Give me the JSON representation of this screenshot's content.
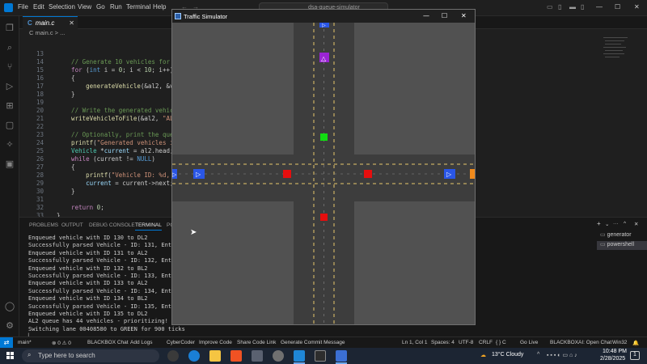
{
  "titlebar": {
    "menu": [
      "File",
      "Edit",
      "Selection",
      "View",
      "Go",
      "Run",
      "Terminal",
      "Help"
    ],
    "search_text": "dsa-queue-simulator"
  },
  "tab": {
    "label": "main.c"
  },
  "breadcrumb": "C main.c > ...",
  "code": [
    {
      "n": "13",
      "parts": []
    },
    {
      "n": "14",
      "parts": [
        [
          "cm",
          "    // Generate 10 vehicles for the la"
        ]
      ]
    },
    {
      "n": "15",
      "parts": [
        [
          "cf",
          "    for"
        ],
        [
          "tx",
          " ("
        ],
        [
          "kw",
          "int"
        ],
        [
          "tx",
          " i = "
        ],
        [
          "nm",
          "0"
        ],
        [
          "tx",
          "; i < "
        ],
        [
          "nm",
          "10"
        ],
        [
          "tx",
          "; i++)"
        ]
      ]
    },
    {
      "n": "16",
      "parts": [
        [
          "tx",
          "    {"
        ]
      ]
    },
    {
      "n": "17",
      "parts": [
        [
          "fn",
          "        generateVehicle"
        ],
        [
          "tx",
          "(&al2, &vehicle"
        ]
      ]
    },
    {
      "n": "18",
      "parts": [
        [
          "tx",
          "    }"
        ]
      ]
    },
    {
      "n": "19",
      "parts": []
    },
    {
      "n": "20",
      "parts": [
        [
          "cm",
          "    // Write the generated vehicles to"
        ]
      ]
    },
    {
      "n": "21",
      "parts": [
        [
          "fn",
          "    writeVehicleToFile"
        ],
        [
          "tx",
          "(&al2, "
        ],
        [
          "st",
          "\"AL2.txt\""
        ]
      ]
    },
    {
      "n": "22",
      "parts": []
    },
    {
      "n": "23",
      "parts": [
        [
          "cm",
          "    // Optionally, print the queue siz"
        ]
      ]
    },
    {
      "n": "24",
      "parts": [
        [
          "fn",
          "    printf"
        ],
        [
          "tx",
          "("
        ],
        [
          "st",
          "\"Generated vehicles in AL2:"
        ]
      ]
    },
    {
      "n": "25",
      "parts": [
        [
          "ty",
          "    Vehicle"
        ],
        [
          "tx",
          " *"
        ],
        [
          "vr",
          "current"
        ],
        [
          "tx",
          " = al2.head;"
        ]
      ]
    },
    {
      "n": "26",
      "parts": [
        [
          "cf",
          "    while"
        ],
        [
          "tx",
          " (current != "
        ],
        [
          "kw",
          "NULL"
        ],
        [
          "tx",
          ")"
        ]
      ]
    },
    {
      "n": "27",
      "parts": [
        [
          "tx",
          "    {"
        ]
      ]
    },
    {
      "n": "28",
      "parts": [
        [
          "fn",
          "        printf"
        ],
        [
          "tx",
          "("
        ],
        [
          "st",
          "\"Vehicle ID: %d, Direct"
        ]
      ]
    },
    {
      "n": "29",
      "parts": [
        [
          "vr",
          "        current"
        ],
        [
          "tx",
          " = current->next;"
        ]
      ]
    },
    {
      "n": "30",
      "parts": [
        [
          "tx",
          "    }"
        ]
      ]
    },
    {
      "n": "31",
      "parts": []
    },
    {
      "n": "32",
      "parts": [
        [
          "cf",
          "    return"
        ],
        [
          "tx",
          " "
        ],
        [
          "nm",
          "0"
        ],
        [
          "tx",
          ";"
        ]
      ]
    },
    {
      "n": "33",
      "parts": [
        [
          "tx",
          "}"
        ]
      ]
    }
  ],
  "panel": {
    "tabs": [
      "PROBLEMS",
      "OUTPUT",
      "DEBUG CONSOLE",
      "TERMINAL",
      "PO"
    ],
    "terminal_lines": [
      "Enqueued vehicle with ID 130 to DL2",
      "Successfully parsed Vehicle - ID: 131, Entry La",
      "Enqueued vehicle with ID 131 to AL2",
      "Successfully parsed Vehicle - ID: 132, Entry La",
      "Enqueued vehicle with ID 132 to BL2",
      "Successfully parsed Vehicle - ID: 133, Entry La",
      "Enqueued vehicle with ID 133 to AL2",
      "Successfully parsed Vehicle - ID: 134, Entry La",
      "Enqueued vehicle with ID 134 to BL2",
      "Successfully parsed Vehicle - ID: 135, Entry La",
      "Enqueued vehicle with ID 135 to DL2",
      "AL2 queue has 44 vehicles - prioritizing!",
      "Switching lane 00408580 to GREEN for 900 ticks",
      "▏"
    ],
    "terminal_list": [
      "generator",
      "powershell"
    ]
  },
  "statusbar": {
    "left": [
      "main*",
      "⊗ 0 ⚠ 0",
      "⎇ 0",
      "BLACKBOX Chat",
      "Add Logs",
      "CyberCoder",
      "Improve Code",
      "Share Code Link",
      "Generate Commit Message"
    ],
    "right": [
      "Ln 1, Col 1",
      "Spaces: 4",
      "UTF-8",
      "CRLF",
      "{ } C",
      "Go Live",
      "BLACKBOXAI: Open Chat",
      "Win32"
    ]
  },
  "taskbar": {
    "search_placeholder": "Type here to search",
    "weather": "13°C  Cloudy",
    "time": "10:48 PM",
    "date": "2/28/2025",
    "notif": "1"
  },
  "simulator": {
    "title": "Traffic Simulator",
    "colors": {
      "background": "#515151",
      "road": "#3d3d3d",
      "lane_line": "#e6c66a",
      "vehicle_blue": "#2a56e6",
      "vehicle_purple": "#9b24d4",
      "vehicle_red": "#e60e0e",
      "vehicle_orange": "#f08a1c",
      "light_green": "#11dd11",
      "light_red": "#e60e0e"
    }
  }
}
